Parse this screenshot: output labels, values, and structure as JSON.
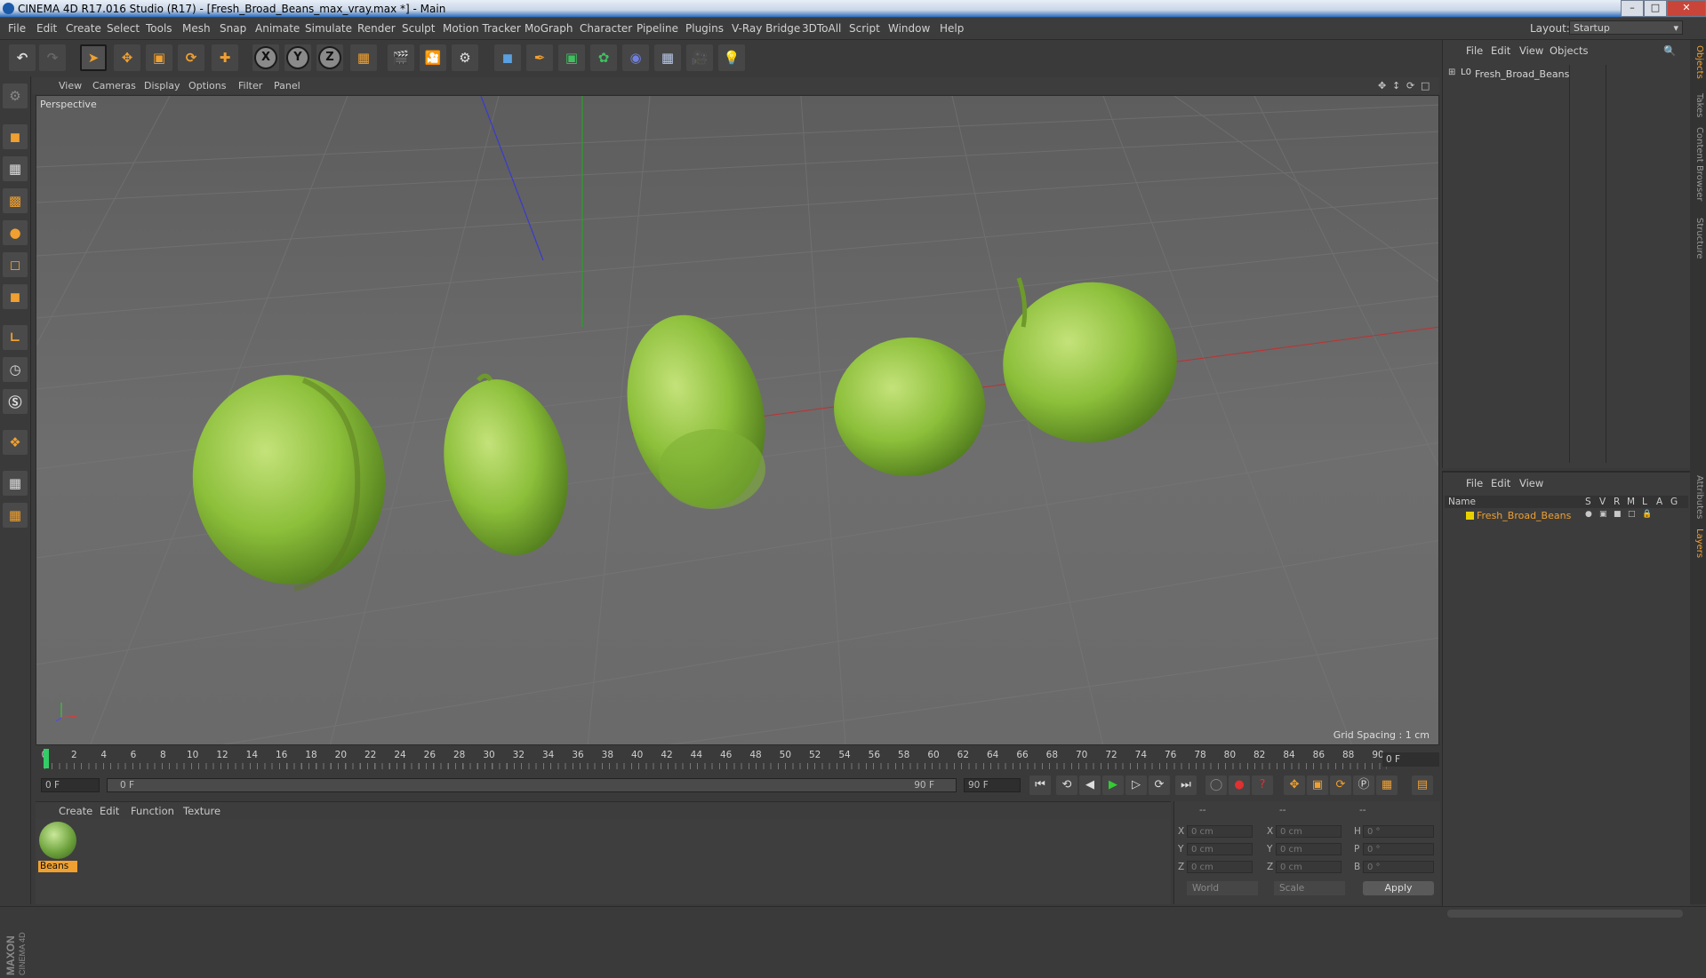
{
  "window": {
    "title": "CINEMA 4D R17.016 Studio (R17) - [Fresh_Broad_Beans_max_vray.max *] - Main",
    "buttons": {
      "minimize": "–",
      "maximize": "□",
      "close": "✕"
    }
  },
  "menubar": {
    "items": [
      "File",
      "Edit",
      "Create",
      "Select",
      "Tools",
      "Mesh",
      "Snap",
      "Animate",
      "Simulate",
      "Render",
      "Sculpt",
      "Motion Tracker",
      "MoGraph",
      "Character",
      "Pipeline",
      "Plugins",
      "V-Ray Bridge",
      "3DToAll",
      "Script",
      "Window",
      "Help"
    ],
    "layout_label": "Layout:",
    "layout_value": "Startup"
  },
  "toolbar": {
    "axis_x": "X",
    "axis_y": "Y",
    "axis_z": "Z"
  },
  "viewport": {
    "menu": [
      "View",
      "Cameras",
      "Display",
      "Options",
      "Filter",
      "Panel"
    ],
    "label": "Perspective",
    "grid_spacing": "Grid Spacing : 1 cm"
  },
  "timeline": {
    "ticks": [
      "0",
      "2",
      "4",
      "6",
      "8",
      "10",
      "12",
      "14",
      "16",
      "18",
      "20",
      "22",
      "24",
      "26",
      "28",
      "30",
      "32",
      "34",
      "36",
      "38",
      "40",
      "42",
      "44",
      "46",
      "48",
      "50",
      "52",
      "54",
      "56",
      "58",
      "60",
      "62",
      "64",
      "66",
      "68",
      "70",
      "72",
      "74",
      "76",
      "78",
      "80",
      "82",
      "84",
      "86",
      "88",
      "90"
    ],
    "current_frame": "0 F",
    "start_field": "0 F",
    "range_start": "0 F",
    "range_end": "90 F",
    "end_field": "90 F"
  },
  "material_manager": {
    "menu": [
      "Create",
      "Edit",
      "Function",
      "Texture"
    ],
    "materials": [
      {
        "name": "Beans"
      }
    ]
  },
  "coordinates": {
    "header": [
      "--",
      "--",
      "--"
    ],
    "rows": [
      {
        "l1": "X",
        "v1": "0 cm",
        "l2": "X",
        "v2": "0 cm",
        "l3": "H",
        "v3": "0 °"
      },
      {
        "l1": "Y",
        "v1": "0 cm",
        "l2": "Y",
        "v2": "0 cm",
        "l3": "P",
        "v3": "0 °"
      },
      {
        "l1": "Z",
        "v1": "0 cm",
        "l2": "Z",
        "v2": "0 cm",
        "l3": "B",
        "v3": "0 °"
      }
    ],
    "mode1": "World",
    "mode2": "Scale",
    "apply": "Apply"
  },
  "object_manager": {
    "menu": [
      "File",
      "Edit",
      "View",
      "Objects"
    ],
    "objects": [
      {
        "name": "Fresh_Broad_Beans"
      }
    ]
  },
  "layer_manager": {
    "menu": [
      "File",
      "Edit",
      "View"
    ],
    "columns": [
      "Name",
      "S",
      "V",
      "R",
      "M",
      "L",
      "A",
      "G"
    ],
    "layers": [
      {
        "name": "Fresh_Broad_Beans",
        "color": "#e8d000"
      }
    ]
  },
  "side_tabs": [
    "Objects",
    "Takes",
    "Content Browser",
    "Structure",
    "Attributes",
    "Layers"
  ],
  "brand": {
    "logo_text": "MAXON CINEMA 4D"
  },
  "colors": {
    "accent": "#f0a030",
    "bean_green": "#8cbf3a"
  }
}
